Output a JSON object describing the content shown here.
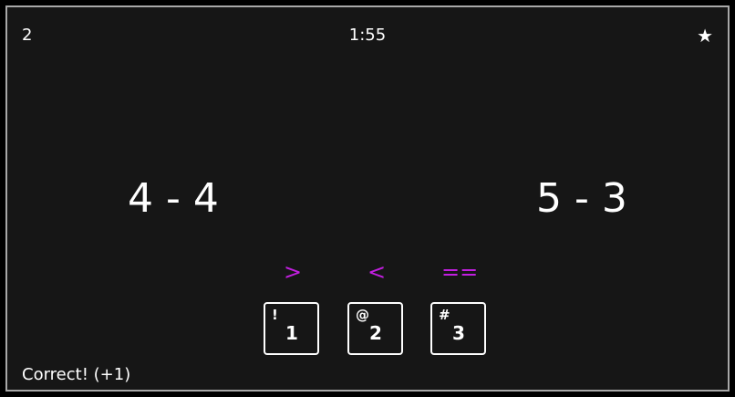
{
  "hud": {
    "score": "2",
    "timer": "1:55",
    "star_icon": "★"
  },
  "expressions": {
    "left": "4 - 4",
    "right": "5 - 3"
  },
  "operators": {
    "greater": ">",
    "less": "<",
    "equal": "=="
  },
  "keys": [
    {
      "shift": "!",
      "num": "1"
    },
    {
      "shift": "@",
      "num": "2"
    },
    {
      "shift": "#",
      "num": "3"
    }
  ],
  "status": "Correct! (+1)",
  "colors": {
    "background": "#161616",
    "border": "#a8a8a8",
    "text": "#ffffff",
    "operator": "#c21fe0"
  }
}
